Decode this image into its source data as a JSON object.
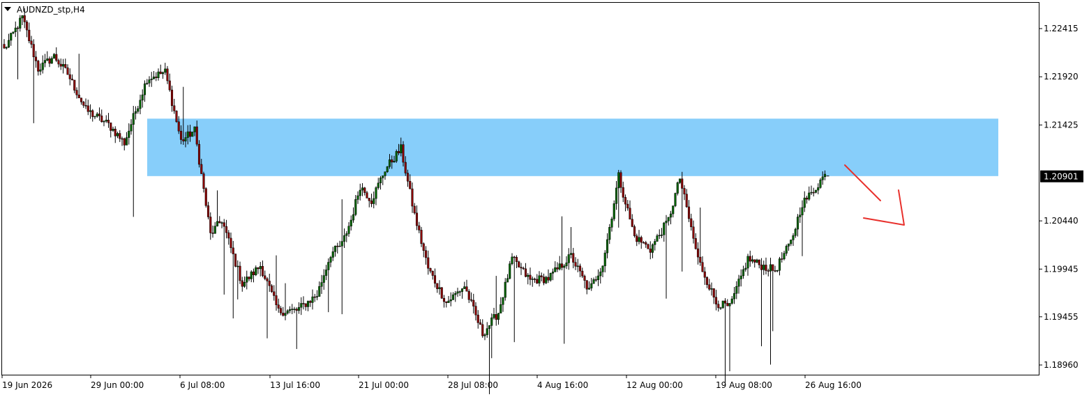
{
  "header": {
    "symbol_timeframe": "AUDNZD_stp,H4",
    "menu_icon": "triangle-down-icon"
  },
  "price_axis": {
    "labels": [
      "1.22415",
      "1.21920",
      "1.21425",
      "1.20440",
      "1.19945",
      "1.19455",
      "1.18960"
    ],
    "current_price": "1.20901"
  },
  "time_axis": {
    "labels": [
      "19 Jun 2026",
      "29 Jun 00:00",
      "6 Jul 08:00",
      "13 Jul 16:00",
      "21 Jul 00:00",
      "28 Jul 08:00",
      "4 Aug 16:00",
      "12 Aug 00:00",
      "19 Aug 08:00",
      "26 Aug 16:00"
    ]
  },
  "colors": {
    "background": "#ffffff",
    "bull_candle": "#006400",
    "bear_candle": "#8b0000",
    "resistance_zone": "#87cefa",
    "arrow": "#e8302c",
    "axis": "#000000",
    "price_tag_bg": "#000000",
    "price_tag_text": "#ffffff"
  },
  "chart_data": {
    "type": "candlestick",
    "symbol": "AUDNZD_stp",
    "timeframe": "H4",
    "ylim": [
      1.1886,
      1.2268
    ],
    "x_tick_labels": [
      "19 Jun 2026",
      "29 Jun 00:00",
      "6 Jul 08:00",
      "13 Jul 16:00",
      "21 Jul 00:00",
      "28 Jul 08:00",
      "4 Aug 16:00",
      "12 Aug 00:00",
      "19 Aug 08:00",
      "26 Aug 16:00"
    ],
    "y_tick_labels": [
      "1.22415",
      "1.21920",
      "1.21425",
      "1.20440",
      "1.19945",
      "1.19455",
      "1.18960"
    ],
    "current_price": 1.20901,
    "resistance_zone": {
      "low": 1.209,
      "high": 1.2149
    },
    "projection_arrow": {
      "direction": "down"
    },
    "anchors": [
      [
        0,
        1.222
      ],
      [
        8,
        1.2253
      ],
      [
        15,
        1.22
      ],
      [
        22,
        1.2213
      ],
      [
        28,
        1.2195
      ],
      [
        36,
        1.2158
      ],
      [
        46,
        1.2143
      ],
      [
        53,
        1.2124
      ],
      [
        63,
        1.219
      ],
      [
        71,
        1.2197
      ],
      [
        78,
        1.2126
      ],
      [
        84,
        1.2137
      ],
      [
        91,
        1.203
      ],
      [
        96,
        1.2045
      ],
      [
        105,
        1.1979
      ],
      [
        113,
        1.1998
      ],
      [
        121,
        1.1951
      ],
      [
        129,
        1.1952
      ],
      [
        138,
        1.1968
      ],
      [
        144,
        1.201
      ],
      [
        149,
        1.202
      ],
      [
        153,
        1.2045
      ],
      [
        157,
        1.208
      ],
      [
        162,
        1.2065
      ],
      [
        168,
        1.2097
      ],
      [
        175,
        1.2118
      ],
      [
        181,
        1.205
      ],
      [
        187,
        1.1995
      ],
      [
        195,
        1.196
      ],
      [
        203,
        1.1977
      ],
      [
        211,
        1.1928
      ],
      [
        218,
        1.195
      ],
      [
        224,
        1.2005
      ],
      [
        232,
        1.1983
      ],
      [
        240,
        1.1985
      ],
      [
        250,
        1.2008
      ],
      [
        258,
        1.1972
      ],
      [
        264,
        1.2
      ],
      [
        268,
        1.205
      ],
      [
        271,
        1.209
      ],
      [
        278,
        1.2028
      ],
      [
        285,
        1.2015
      ],
      [
        293,
        1.2045
      ],
      [
        298,
        1.2088
      ],
      [
        306,
        1.2005
      ],
      [
        314,
        1.196
      ],
      [
        320,
        1.1955
      ],
      [
        328,
        1.2005
      ],
      [
        334,
        1.1998
      ],
      [
        340,
        1.1993
      ],
      [
        347,
        1.2022
      ],
      [
        352,
        1.2062
      ],
      [
        356,
        1.2072
      ],
      [
        362,
        1.2092
      ]
    ]
  }
}
